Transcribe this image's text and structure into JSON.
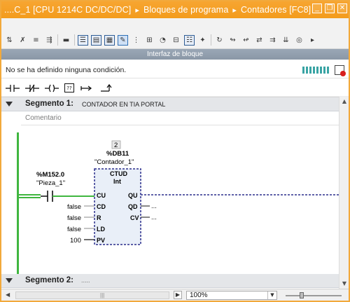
{
  "titlebar": {
    "device": "....C_1 [CPU 1214C DC/DC/DC]",
    "sep1": "▸",
    "folder": "Bloques de programa",
    "sep2": "▸",
    "block": "Contadores [FC8]",
    "minimize": "_",
    "restore": "❐",
    "close": "✕"
  },
  "interface_bar": {
    "label": "Interfaz de bloque"
  },
  "condition": {
    "text": "No se ha definido ninguna condición."
  },
  "ladder_tools": {
    "nc_contact_icon": "⊣/⊢",
    "box_label": "??"
  },
  "segment1": {
    "label": "Segmento 1:",
    "name": "CONTADOR EN TIA PORTAL",
    "comment_placeholder": "Comentario"
  },
  "counter": {
    "instance_number": "2",
    "instance_db": "%DB11",
    "instance_name": "\"Contador_1\"",
    "type": "CTUD",
    "datatype": "Int",
    "pins_in": [
      "CU",
      "CD",
      "R",
      "LD",
      "PV"
    ],
    "pins_out": [
      "QU",
      "QD",
      "CV"
    ],
    "values": {
      "cd": "false",
      "r": "false",
      "ld": "false",
      "pv": "100"
    },
    "output_dots": "..."
  },
  "contact": {
    "address": "%M152.0",
    "tag": "\"Pieza_1\""
  },
  "segment2": {
    "label": "Segmento 2:",
    "name": "....."
  },
  "hscroll": {
    "thumb": "|||",
    "zoom": "100%"
  }
}
